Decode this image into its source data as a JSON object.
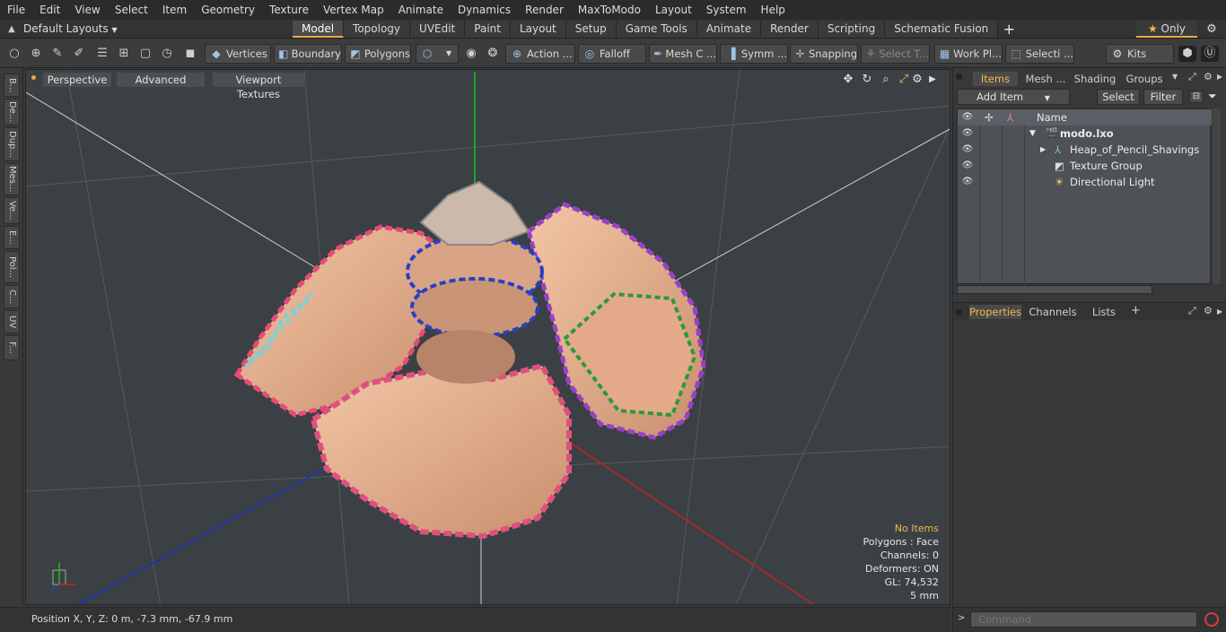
{
  "menu": [
    "File",
    "Edit",
    "View",
    "Select",
    "Item",
    "Geometry",
    "Texture",
    "Vertex Map",
    "Animate",
    "Dynamics",
    "Render",
    "MaxToModo",
    "Layout",
    "System",
    "Help"
  ],
  "layoutbar": {
    "layout_select": "Default Layouts",
    "tabs": [
      "Model",
      "Topology",
      "UVEdit",
      "Paint",
      "Layout",
      "Setup",
      "Game Tools",
      "Animate",
      "Render",
      "Scripting",
      "Schematic Fusion"
    ],
    "active_tab": "Model",
    "only_label": "Only"
  },
  "toolbar": {
    "vertices": "Vertices",
    "boundary": "Boundary",
    "polygons": "Polygons",
    "action": "Action ...",
    "falloff": "Falloff",
    "mesh": "Mesh C ...",
    "symm": "Symm ...",
    "snapping": "Snapping",
    "select_t": "Select T...",
    "work_pl": "Work Pl...",
    "selecti": "Selecti ...",
    "kits": "Kits"
  },
  "leftstrip": [
    "B...",
    "De...",
    "Dup...",
    "Mes...",
    "Ve...",
    "E...",
    "Pol...",
    "C...",
    "UV",
    "F..."
  ],
  "viewport": {
    "perspective": "Perspective",
    "advanced": "Advanced",
    "textures": "Viewport Textures",
    "info": {
      "no_items": "No Items",
      "polygons": "Polygons : Face",
      "channels": "Channels: 0",
      "deformers": "Deformers: ON",
      "gl": "GL: 74,532",
      "scale": "5 mm"
    }
  },
  "status": {
    "position": "Position X, Y, Z:  0 m, -7.3 mm, -67.9 mm"
  },
  "items_panel": {
    "tabs": [
      "Items",
      "Mesh ...",
      "Shading",
      "Groups"
    ],
    "add_item": "Add Item",
    "select": "Select",
    "filter": "Filter",
    "name_col": "Name",
    "rows": [
      {
        "label": "modo.lxo",
        "indent": 0
      },
      {
        "label": "Heap_of_Pencil_Shavings",
        "indent": 1
      },
      {
        "label": "Texture Group",
        "indent": 1
      },
      {
        "label": "Directional Light",
        "indent": 1
      }
    ]
  },
  "props_panel": {
    "tabs": [
      "Properties",
      "Channels",
      "Lists"
    ]
  },
  "command": {
    "placeholder": "Command"
  },
  "colors": {
    "accent": "#e8a94a",
    "viewport_bg": "#3a4044"
  }
}
